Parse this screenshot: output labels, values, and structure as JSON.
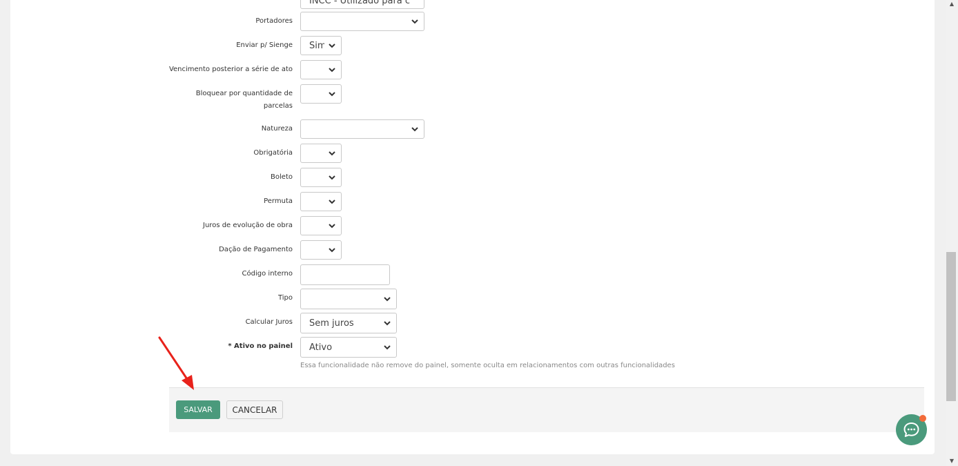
{
  "form": {
    "partial_top_value": "INCC - Utilizado para c",
    "fields": [
      {
        "label": "Portadores",
        "value": ""
      },
      {
        "label": "Enviar p/ Sienge",
        "value": "Sim"
      },
      {
        "label": "Vencimento posterior a série de ato",
        "value": ""
      },
      {
        "label_line1": "Bloquear por quantidade de",
        "label_line2": "parcelas",
        "value": ""
      },
      {
        "label": "Natureza",
        "value": ""
      },
      {
        "label": "Obrigatória",
        "value": ""
      },
      {
        "label": "Boleto",
        "value": ""
      },
      {
        "label": "Permuta",
        "value": ""
      },
      {
        "label": "Juros de evolução de obra",
        "value": ""
      },
      {
        "label": "Dação de Pagamento",
        "value": ""
      },
      {
        "label": "Código interno",
        "value": ""
      },
      {
        "label": "Tipo",
        "value": ""
      },
      {
        "label": "Calcular Juros",
        "value": "Sem juros"
      },
      {
        "label": "Ativo no painel",
        "required_mark": "*",
        "value": "Ativo"
      }
    ],
    "hint": "Essa funcionalidade não remove do painel, somente oculta em relacionamentos com outras funcionalidades"
  },
  "footer": {
    "save_label": "SALVAR",
    "cancel_label": "CANCELAR"
  },
  "chat": {
    "icon": "chat-bubble-icon",
    "badge_color": "#f26b3a"
  },
  "colors": {
    "primary": "#4a9a7c",
    "annotation_arrow": "#e8221b"
  }
}
